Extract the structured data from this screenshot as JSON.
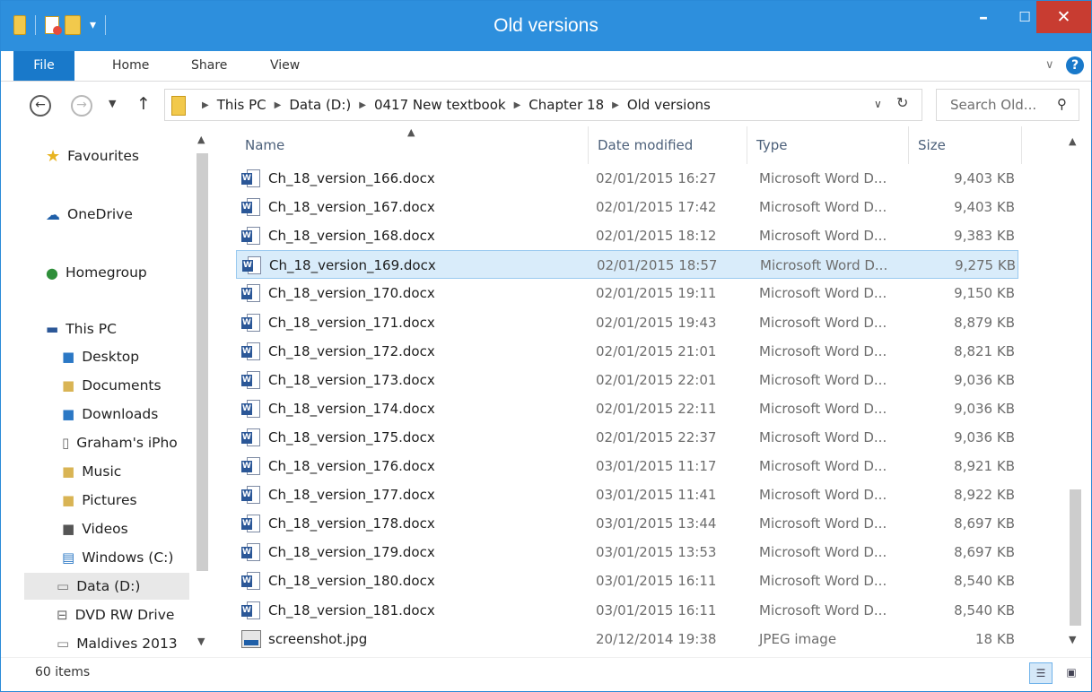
{
  "window": {
    "title": "Old versions"
  },
  "ribbon": {
    "tabs": [
      "File",
      "Home",
      "Share",
      "View"
    ]
  },
  "address": {
    "crumbs": [
      "This PC",
      "Data (D:)",
      "0417 New textbook",
      "Chapter 18",
      "Old versions"
    ]
  },
  "search": {
    "placeholder": "Search Old..."
  },
  "navpane": {
    "items": [
      {
        "label": "Favourites",
        "icon": "star-icon"
      },
      {
        "label": "OneDrive",
        "icon": "cloud-icon"
      },
      {
        "label": "Homegroup",
        "icon": "homegroup-icon"
      },
      {
        "label": "This PC",
        "icon": "computer-icon"
      },
      {
        "label": "Desktop",
        "icon": "desktop-folder-icon"
      },
      {
        "label": "Documents",
        "icon": "documents-folder-icon"
      },
      {
        "label": "Downloads",
        "icon": "downloads-folder-icon"
      },
      {
        "label": "Graham's iPho",
        "icon": "phone-icon"
      },
      {
        "label": "Music",
        "icon": "music-folder-icon"
      },
      {
        "label": "Pictures",
        "icon": "pictures-folder-icon"
      },
      {
        "label": "Videos",
        "icon": "videos-folder-icon"
      },
      {
        "label": "Windows (C:)",
        "icon": "windows-drive-icon"
      },
      {
        "label": "Data (D:)",
        "icon": "drive-icon"
      },
      {
        "label": "DVD RW Drive",
        "icon": "dvd-drive-icon"
      },
      {
        "label": "Maldives 2013",
        "icon": "drive-icon"
      }
    ]
  },
  "columns": {
    "name": "Name",
    "date": "Date modified",
    "type": "Type",
    "size": "Size"
  },
  "files": [
    {
      "name": "Ch_18_version_166.docx",
      "date": "02/01/2015 16:27",
      "type": "Microsoft Word D...",
      "size": "9,403 KB"
    },
    {
      "name": "Ch_18_version_167.docx",
      "date": "02/01/2015 17:42",
      "type": "Microsoft Word D...",
      "size": "9,403 KB"
    },
    {
      "name": "Ch_18_version_168.docx",
      "date": "02/01/2015 18:12",
      "type": "Microsoft Word D...",
      "size": "9,383 KB"
    },
    {
      "name": "Ch_18_version_169.docx",
      "date": "02/01/2015 18:57",
      "type": "Microsoft Word D...",
      "size": "9,275 KB"
    },
    {
      "name": "Ch_18_version_170.docx",
      "date": "02/01/2015 19:11",
      "type": "Microsoft Word D...",
      "size": "9,150 KB"
    },
    {
      "name": "Ch_18_version_171.docx",
      "date": "02/01/2015 19:43",
      "type": "Microsoft Word D...",
      "size": "8,879 KB"
    },
    {
      "name": "Ch_18_version_172.docx",
      "date": "02/01/2015 21:01",
      "type": "Microsoft Word D...",
      "size": "8,821 KB"
    },
    {
      "name": "Ch_18_version_173.docx",
      "date": "02/01/2015 22:01",
      "type": "Microsoft Word D...",
      "size": "9,036 KB"
    },
    {
      "name": "Ch_18_version_174.docx",
      "date": "02/01/2015 22:11",
      "type": "Microsoft Word D...",
      "size": "9,036 KB"
    },
    {
      "name": "Ch_18_version_175.docx",
      "date": "02/01/2015 22:37",
      "type": "Microsoft Word D...",
      "size": "9,036 KB"
    },
    {
      "name": "Ch_18_version_176.docx",
      "date": "03/01/2015 11:17",
      "type": "Microsoft Word D...",
      "size": "8,921 KB"
    },
    {
      "name": "Ch_18_version_177.docx",
      "date": "03/01/2015 11:41",
      "type": "Microsoft Word D...",
      "size": "8,922 KB"
    },
    {
      "name": "Ch_18_version_178.docx",
      "date": "03/01/2015 13:44",
      "type": "Microsoft Word D...",
      "size": "8,697 KB"
    },
    {
      "name": "Ch_18_version_179.docx",
      "date": "03/01/2015 13:53",
      "type": "Microsoft Word D...",
      "size": "8,697 KB"
    },
    {
      "name": "Ch_18_version_180.docx",
      "date": "03/01/2015 16:11",
      "type": "Microsoft Word D...",
      "size": "8,540 KB"
    },
    {
      "name": "Ch_18_version_181.docx",
      "date": "03/01/2015 16:11",
      "type": "Microsoft Word D...",
      "size": "8,540 KB"
    },
    {
      "name": "screenshot.jpg",
      "date": "20/12/2014 19:38",
      "type": "JPEG image",
      "size": "18 KB"
    }
  ],
  "status": {
    "count": "60 items"
  },
  "colors": {
    "titlebar": "#2d8fdd",
    "file_tab": "#1979ca",
    "close_button": "#c83c31",
    "selection": "#d9ecfa"
  }
}
